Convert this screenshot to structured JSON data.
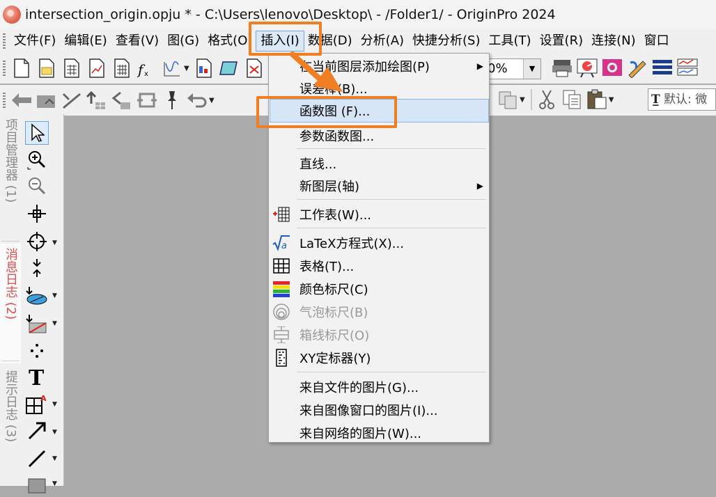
{
  "window": {
    "title": "intersection_origin.opju * - C:\\Users\\lenovo\\Desktop\\ - /Folder1/ - OriginPro 2024"
  },
  "menubar": {
    "items": [
      {
        "label": "文件(F)"
      },
      {
        "label": "编辑(E)"
      },
      {
        "label": "查看(V)"
      },
      {
        "label": "图(G)"
      },
      {
        "label": "格式(O)"
      },
      {
        "label": "插入(I)"
      },
      {
        "label": "数据(D)"
      },
      {
        "label": "分析(A)"
      },
      {
        "label": "快捷分析(S)"
      },
      {
        "label": "工具(T)"
      },
      {
        "label": "设置(R)"
      },
      {
        "label": "连接(N)"
      },
      {
        "label": "窗口"
      }
    ]
  },
  "toolbar": {
    "zoom_value": "0%",
    "font_label": "默认: 微"
  },
  "leftdock": {
    "tabs": [
      {
        "label": "项目管理器 (1)"
      },
      {
        "label": "消息日志 (2)"
      },
      {
        "label": "提示日志 (3)"
      }
    ]
  },
  "insert_menu": {
    "items": [
      {
        "label": "在当前图层添加绘图(P)",
        "submenu": true
      },
      {
        "label": "误差棒(B)..."
      },
      {
        "label": "函数图 (F)..."
      },
      {
        "label": "参数函数图..."
      },
      {
        "label": "直线..."
      },
      {
        "label": "新图层(轴)",
        "submenu": true
      },
      {
        "label": "工作表(W)..."
      },
      {
        "label": "LaTeX方程式(X)..."
      },
      {
        "label": "表格(T)..."
      },
      {
        "label": "颜色标尺(C)"
      },
      {
        "label": "气泡标尺(B)"
      },
      {
        "label": "箱线标尺(O)"
      },
      {
        "label": "XY定标器(Y)"
      },
      {
        "label": "来自文件的图片(G)..."
      },
      {
        "label": "来自图像窗口的图片(I)..."
      },
      {
        "label": "来自网络的图片(W)..."
      }
    ]
  },
  "highlight": {
    "color": "#f07f23"
  }
}
